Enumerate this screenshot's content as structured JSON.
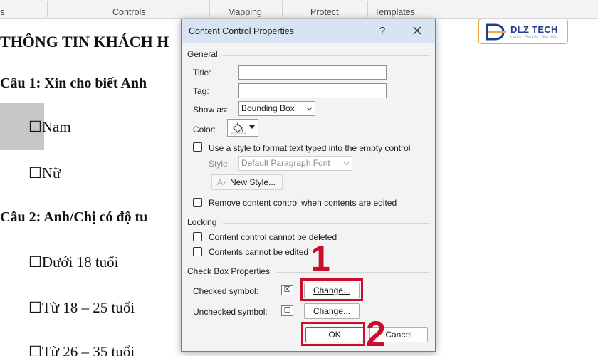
{
  "ribbon": {
    "groups": [
      {
        "label": "s"
      },
      {
        "label": "Controls"
      },
      {
        "label": "Mapping"
      },
      {
        "label": "Protect"
      },
      {
        "label": "Templates"
      }
    ]
  },
  "document": {
    "heading": "THÔNG TIN KHÁCH H",
    "q1": "Câu 1: Xin cho biết Anh",
    "q1_options": [
      "☐Nam",
      "☐Nữ"
    ],
    "q2": "Câu 2: Anh/Chị có độ tu",
    "q2_options": [
      "☐Dưới 18 tuổi",
      "☐Từ 18 – 25 tuổi",
      "☐Từ 26 – 35 tuổi"
    ]
  },
  "logo": {
    "brand": "DLZ TECH",
    "tagline": "Laptop • Phụ kiện • Sửa chữa"
  },
  "dialog": {
    "title": "Content Control Properties",
    "help": "?",
    "general": {
      "section": "General",
      "title_label": "Title:",
      "title_value": "",
      "tag_label": "Tag:",
      "tag_value": "",
      "show_as_label": "Show as:",
      "show_as_value": "Bounding Box",
      "color_label": "Color:",
      "use_style_label": "Use a style to format text typed into the empty control",
      "style_label": "Style:",
      "style_value": "Default Paragraph Font",
      "new_style_label": "New Style...",
      "remove_label": "Remove content control when contents are edited"
    },
    "locking": {
      "section": "Locking",
      "cannot_delete_label": "Content control cannot be deleted",
      "cannot_edit_label": "Contents cannot be edited"
    },
    "checkbox": {
      "section": "Check Box Properties",
      "checked_label": "Checked symbol:",
      "checked_symbol": "☒",
      "unchecked_label": "Unchecked symbol:",
      "unchecked_symbol": "☐",
      "change_label": "Change..."
    },
    "ok_label": "OK",
    "cancel_label": "Cancel"
  },
  "annotations": {
    "step1": "1",
    "step2": "2",
    "color": "#c8102e"
  }
}
